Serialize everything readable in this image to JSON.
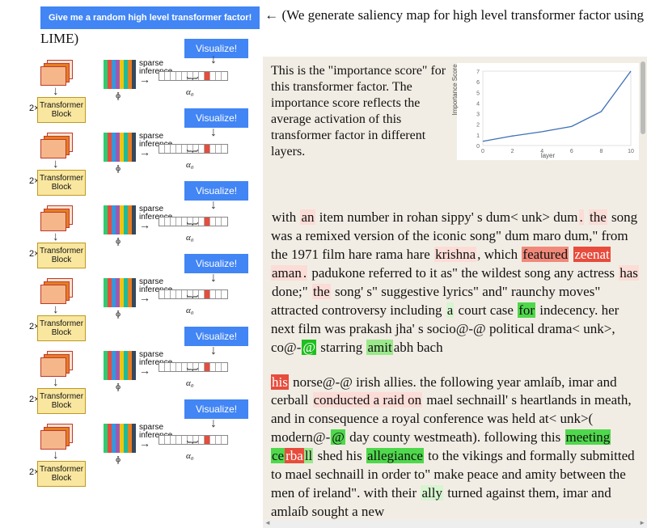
{
  "header": {
    "random_button": "Give me a random high level transformer factor!",
    "arrow": "←",
    "note": "(We generate saliency map for high level transformer factor using",
    "note2": "LIME)"
  },
  "blocks": {
    "two_x": "2×",
    "tb_line1": "Transformer",
    "tb_line2": "Block",
    "sparse_l1": "sparse",
    "sparse_l2": "inference",
    "alpha": "α₀",
    "visualize": "Visualize!",
    "phi": "ɸ"
  },
  "right": {
    "description": "This is the \"importance score\" for this transformer factor. The importance score reflects the average activation of this transformer factor in different layers."
  },
  "chart_data": {
    "type": "line",
    "x": [
      0,
      2,
      4,
      6,
      8,
      10
    ],
    "y": [
      0.4,
      0.9,
      1.3,
      1.8,
      3.2,
      7.0
    ],
    "xlabel": "layer",
    "ylabel": "Importance Score",
    "xlim": [
      0,
      10
    ],
    "ylim": [
      0,
      7
    ],
    "yticks": [
      0,
      1,
      2,
      3,
      4,
      5,
      6,
      7
    ]
  },
  "passages": {
    "p1": [
      {
        "t": "with ",
        "c": ""
      },
      {
        "t": "an",
        "c": "r1"
      },
      {
        "t": " item number in rohan sippy' s dum< unk> dum",
        "c": ""
      },
      {
        "t": ".",
        "c": "r1"
      },
      {
        "t": " ",
        "c": ""
      },
      {
        "t": "the",
        "c": "r1"
      },
      {
        "t": " song was a remixed version of the iconic song\" dum maro dum,\" from the 1971 film hare rama hare ",
        "c": ""
      },
      {
        "t": "krishna",
        "c": "r1"
      },
      {
        "t": ", which ",
        "c": ""
      },
      {
        "t": "featured",
        "c": "r3"
      },
      {
        "t": " ",
        "c": ""
      },
      {
        "t": "zeenat",
        "c": "r4"
      },
      {
        "t": " ",
        "c": ""
      },
      {
        "t": "aman",
        "c": "r1"
      },
      {
        "t": ".",
        "c": "r1"
      },
      {
        "t": " padukone referred to it as\" the wildest song any actress ",
        "c": ""
      },
      {
        "t": "has",
        "c": "r1"
      },
      {
        "t": " done;\" ",
        "c": ""
      },
      {
        "t": "the",
        "c": "r1"
      },
      {
        "t": " song' s\" suggestive lyrics\" and\" raunchy moves\" attracted controversy including ",
        "c": ""
      },
      {
        "t": "a",
        "c": "g1"
      },
      {
        "t": " court case ",
        "c": ""
      },
      {
        "t": "for",
        "c": "g3"
      },
      {
        "t": " indecency. her next film was prakash jha' s socio@-@ political drama< unk>, co@-",
        "c": ""
      },
      {
        "t": "@",
        "c": "g4"
      },
      {
        "t": " starring ",
        "c": ""
      },
      {
        "t": "amit",
        "c": "g2"
      },
      {
        "t": "abh bach",
        "c": ""
      }
    ],
    "p2": [
      {
        "t": "his",
        "c": "r4"
      },
      {
        "t": " norse@-@ irish allies. the following year amlaíb, imar and cerball ",
        "c": ""
      },
      {
        "t": "conducted a raid on",
        "c": "r1"
      },
      {
        "t": " mael sechnaill' s heartlands in meath, and in consequence a royal conference was held at< unk>( modern@-",
        "c": ""
      },
      {
        "t": "@",
        "c": "g3"
      },
      {
        "t": " day county westmeath). following this ",
        "c": ""
      },
      {
        "t": "meeting",
        "c": "g3"
      },
      {
        "t": " ",
        "c": ""
      },
      {
        "t": "ce",
        "c": "g3"
      },
      {
        "t": "rba",
        "c": "r4"
      },
      {
        "t": "ll",
        "c": "g2"
      },
      {
        "t": " shed his ",
        "c": ""
      },
      {
        "t": "allegiance",
        "c": "g3"
      },
      {
        "t": " to the vikings and formally submitted to mael sechnaill in order to\" make peace and amity between the men of ireland\". with their ",
        "c": ""
      },
      {
        "t": "ally",
        "c": "g1"
      },
      {
        "t": " turned against them, imar and amlaíb sought a new",
        "c": ""
      }
    ]
  }
}
